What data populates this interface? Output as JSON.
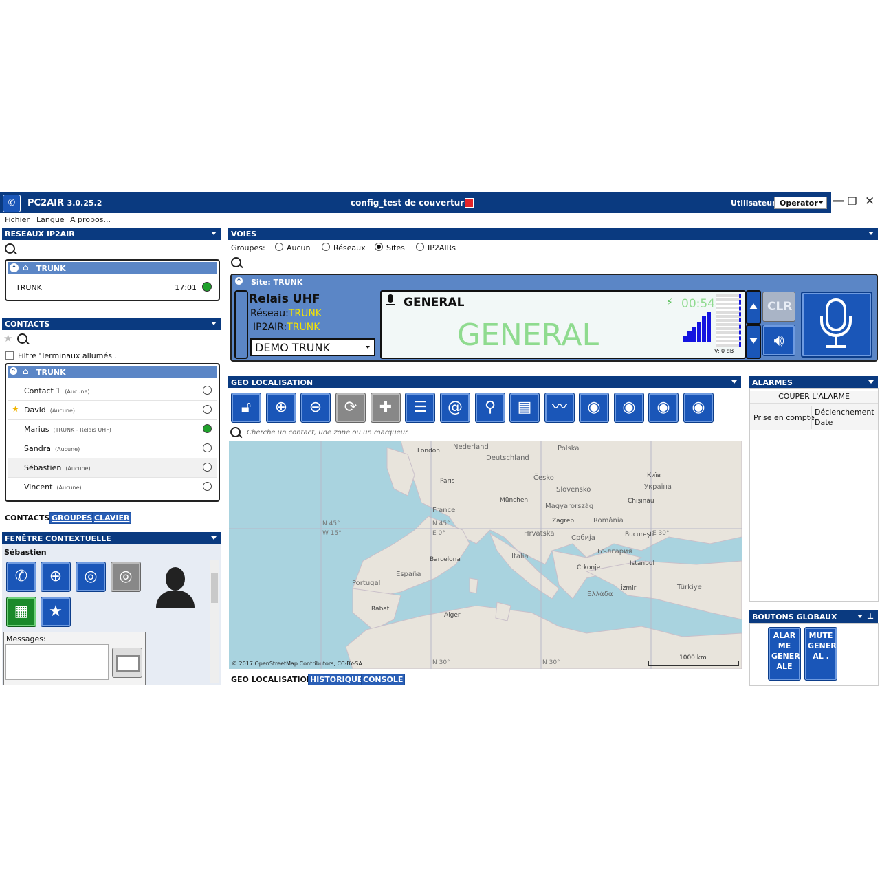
{
  "titlebar": {
    "app_name": "PC2AIR",
    "version": "3.0.25.2",
    "config": "config_test de couverture",
    "user_label": "Utilisateur:",
    "user_value": "Operator"
  },
  "menu": [
    "Fichier",
    "Langue",
    "A propos..."
  ],
  "networks": {
    "header": "RESEAUX IP2AIR",
    "group": "TRUNK",
    "item_name": "TRUNK",
    "item_time": "17:01",
    "status_color": "#1fa12b"
  },
  "contacts": {
    "header": "CONTACTS",
    "filter_label": "Filtre 'Terminaux allumés'.",
    "group": "TRUNK",
    "items": [
      {
        "name": "Contact 1",
        "sub": "(Aucune)",
        "favorite": false,
        "online": false
      },
      {
        "name": "David",
        "sub": "(Aucune)",
        "favorite": true,
        "online": false
      },
      {
        "name": "Marius",
        "sub": "(TRUNK - Relais UHF)",
        "favorite": false,
        "online": true
      },
      {
        "name": "Sandra",
        "sub": "(Aucune)",
        "favorite": false,
        "online": false
      },
      {
        "name": "Sébastien",
        "sub": "(Aucune)",
        "favorite": false,
        "online": false
      },
      {
        "name": "Vincent",
        "sub": "(Aucune)",
        "favorite": false,
        "online": false
      }
    ],
    "tabs": [
      "CONTACTS",
      "GROUPES",
      "CLAVIER"
    ]
  },
  "context": {
    "header": "FENÊTRE CONTEXTUELLE",
    "name": "Sébastien",
    "messages_label": "Messages:"
  },
  "voies": {
    "header": "VOIES",
    "groups_label": "Groupes:",
    "radios": [
      "Aucun",
      "Réseaux",
      "Sites",
      "IP2AIRs"
    ],
    "selected": "Sites",
    "site_header": "Site: TRUNK",
    "relay_name": "Relais UHF",
    "reseau_label": "Réseau:",
    "reseau_value": "TRUNK",
    "ip2air_label": "IP2AIR:",
    "ip2air_value": "TRUNK",
    "channel_select": "DEMO TRUNK",
    "call_title": "GENERAL",
    "call_big": "GENERAL",
    "timer": "00:54",
    "vu_label": "V: 0 dB",
    "clr_label": "CLR"
  },
  "geo": {
    "header": "GEO LOCALISATION",
    "search_placeholder": "Cherche un contact, une zone ou un marqueur.",
    "copyright": "© 2017 OpenStreetMap Contributors, CC-BY-SA",
    "scale": "1000 km",
    "labels": [
      "London",
      "Nederland",
      "Deutschland",
      "Polska",
      "Paris",
      "Česko",
      "Київ",
      "Slovensko",
      "Україна",
      "München",
      "Chișinău",
      "France",
      "Magyarország",
      "Zagreb",
      "România",
      "Hrvatska",
      "Србија",
      "Bucureşti",
      "Italia",
      "България",
      "Barcelona",
      "España",
      "Crkonje",
      "Istanbul",
      "Portugal",
      "Ελλάδα",
      "İzmir",
      "Türkiye",
      "Rabat",
      "Alger",
      "N 45°",
      "W 15°",
      "E 0°",
      "N 45°",
      "E 30°",
      "N 30°",
      "N 30°"
    ],
    "tabs": [
      "GEO LOCALISATION",
      "HISTORIQUE",
      "CONSOLE"
    ]
  },
  "alarms": {
    "header": "ALARMES",
    "cut": "COUPER L'ALARME",
    "col1": "Prise en compte",
    "col2": "Déclenchement Date"
  },
  "global_buttons": {
    "header": "BOUTONS GLOBAUX",
    "alarm": "ALAR ME GENER ALE",
    "mute": "MUTE GENER AL ."
  },
  "colors": {
    "primary": "#0a3a80",
    "panel_header": "#5b86c6",
    "button_blue": "#1a56b8",
    "online": "#1fa12b",
    "call_text": "#8fdb8f"
  }
}
